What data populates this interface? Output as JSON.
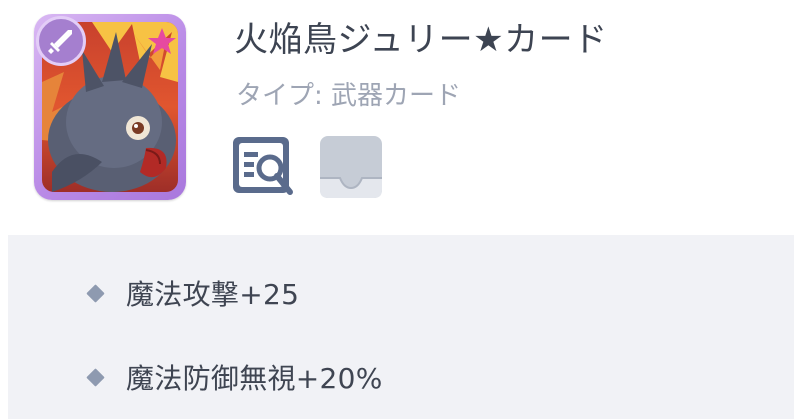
{
  "card": {
    "title": "火焔鳥ジュリー★カード",
    "type_line": "タイプ: 武器カード",
    "badge_icon": "sword-icon",
    "art": "fire-bird-artwork",
    "frame_color": "#b98ae6"
  },
  "actions": {
    "view_icon": "magnify-document-icon",
    "tray_icon": "inbox-tray-icon"
  },
  "stats": [
    {
      "text": "魔法攻撃+25"
    },
    {
      "text": "魔法防御無視+20%"
    }
  ],
  "colors": {
    "title": "#3d4452",
    "subtitle": "#9ea5b4",
    "panel_bg": "#f1f2f6",
    "bullet": "#8e9ab0",
    "icon_active": "#5a6b8c",
    "icon_disabled": "#c6ccd6"
  }
}
